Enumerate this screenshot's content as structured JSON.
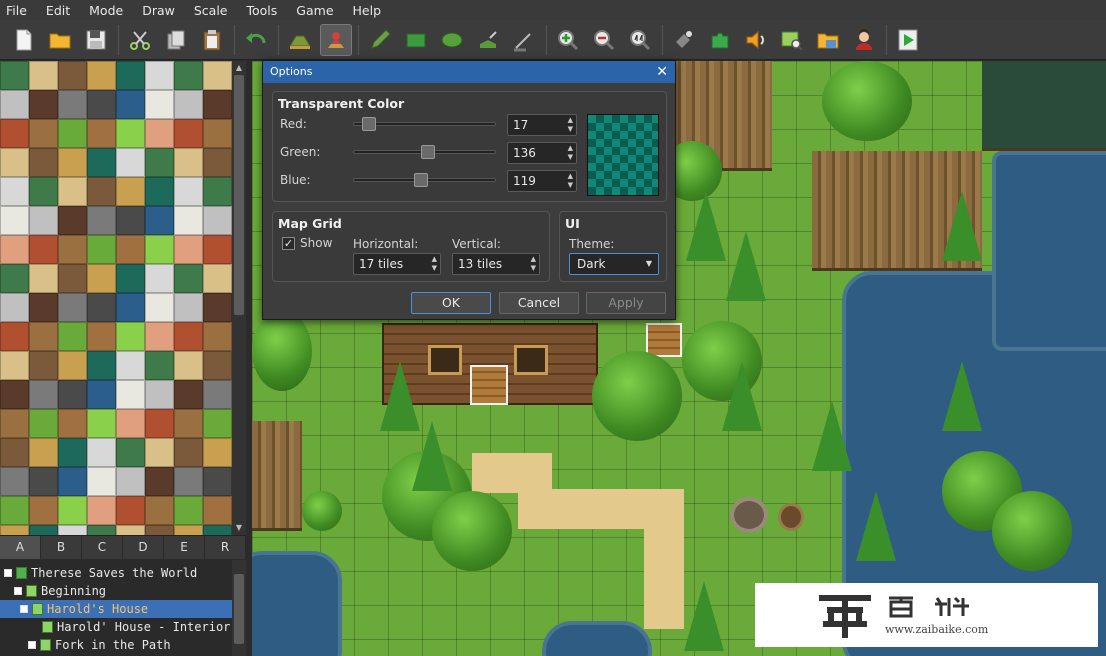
{
  "menubar": {
    "items": [
      "File",
      "Edit",
      "Mode",
      "Draw",
      "Scale",
      "Tools",
      "Game",
      "Help"
    ]
  },
  "toolbar": {
    "buttons": [
      "new-project",
      "open-project",
      "save-project",
      "cut",
      "copy",
      "paste",
      "undo",
      "map-layer",
      "event-layer",
      "pencil",
      "rectangle",
      "ellipse",
      "flood-fill",
      "shadow-pen",
      "zoom-in",
      "zoom-out",
      "zoom-actual",
      "database",
      "resource-manager",
      "sound-test",
      "event-searcher",
      "character-generator",
      "playtest"
    ],
    "active": "event-layer"
  },
  "layer_tabs": [
    "A",
    "B",
    "C",
    "D",
    "E",
    "R"
  ],
  "map_tree": {
    "items": [
      {
        "label": "Therese Saves the World",
        "level": 0,
        "type": "project"
      },
      {
        "label": "Beginning",
        "level": 1,
        "type": "map"
      },
      {
        "label": "Harold's House",
        "level": 1,
        "type": "map",
        "selected": true
      },
      {
        "label": "Harold' House - Interior",
        "level": 2,
        "type": "map"
      },
      {
        "label": "Fork in the Path",
        "level": 1,
        "type": "map"
      }
    ]
  },
  "dialog": {
    "title": "Options",
    "transparent_color": {
      "title": "Transparent Color",
      "red_label": "Red:",
      "green_label": "Green:",
      "blue_label": "Blue:",
      "red": "17",
      "green": "136",
      "blue": "119",
      "red_level": 0.07,
      "green_level": 0.53,
      "blue_level": 0.47,
      "swatch_color": "#118877"
    },
    "map_grid": {
      "title": "Map Grid",
      "show_label": "Show",
      "show_checked": true,
      "horizontal_label": "Horizontal:",
      "vertical_label": "Vertical:",
      "horizontal": "17 tiles",
      "vertical": "13 tiles"
    },
    "ui": {
      "title": "UI",
      "theme_label": "Theme:",
      "theme": "Dark"
    },
    "buttons": {
      "ok": "OK",
      "cancel": "Cancel",
      "apply": "Apply"
    }
  },
  "watermark": {
    "url": "www.zaibaike.com"
  }
}
